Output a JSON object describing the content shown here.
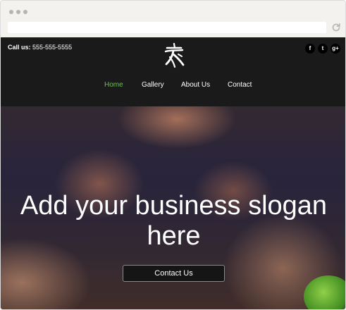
{
  "header": {
    "call_label": "Call us:",
    "phone": "555-555-5555"
  },
  "logo": {
    "icon": "calligraphy-logo-icon"
  },
  "social": {
    "facebook": "f",
    "twitter": "t",
    "google_plus": "g+"
  },
  "nav": {
    "items": [
      {
        "label": "Home",
        "active": true
      },
      {
        "label": "Gallery",
        "active": false
      },
      {
        "label": "About Us",
        "active": false
      },
      {
        "label": "Contact",
        "active": false
      }
    ]
  },
  "hero": {
    "slogan": "Add your business slogan here",
    "cta_label": "Contact Us"
  },
  "colors": {
    "header_bg": "#1a1a1a",
    "nav_active": "#6cc24a",
    "chrome_bg": "#f4f2ef"
  }
}
